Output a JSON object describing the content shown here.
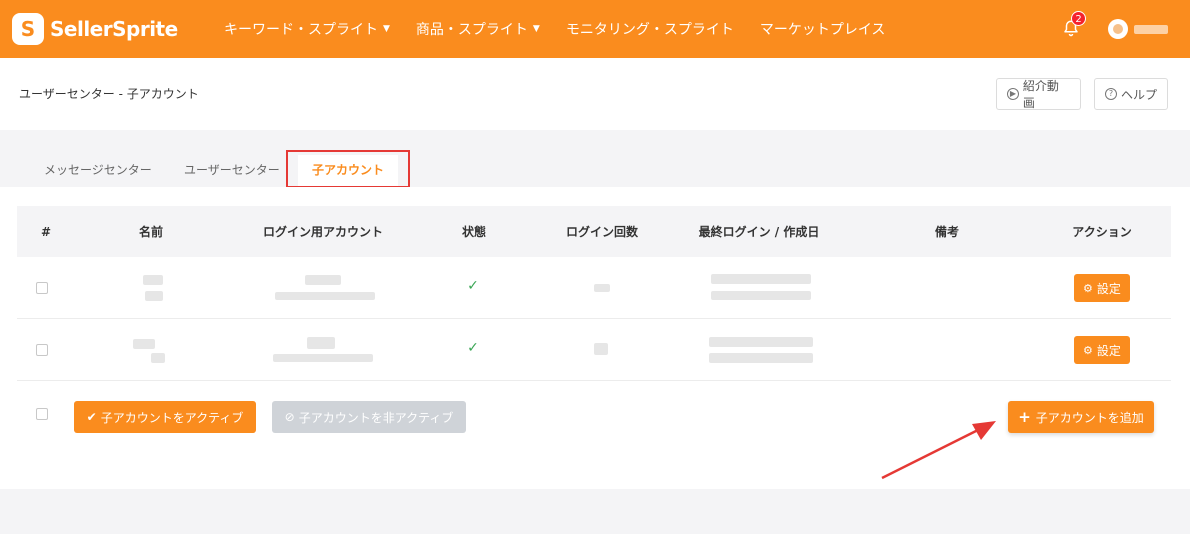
{
  "nav": {
    "brand": "SellerSprite",
    "items": [
      {
        "label": "キーワード・スプライト",
        "has_dropdown": true
      },
      {
        "label": "商品・スプライト",
        "has_dropdown": true
      },
      {
        "label": "モニタリング・スプライト",
        "has_dropdown": false
      },
      {
        "label": "マーケットプレイス",
        "has_dropdown": false
      }
    ],
    "notification_count": "2"
  },
  "header": {
    "breadcrumb": "ユーザーセンター - 子アカウント",
    "video_button": "紹介動画",
    "help_button": "ヘルプ"
  },
  "tabs": {
    "items": [
      "メッセージセンター",
      "ユーザーセンター",
      "子アカウント"
    ],
    "active": "子アカウント"
  },
  "table": {
    "columns": [
      "#",
      "名前",
      "ログイン用アカウント",
      "状態",
      "ログイン回数",
      "最終ログイン / 作成日",
      "備考",
      "アクション"
    ],
    "rows": [
      {
        "status": "✓",
        "action": "設定"
      },
      {
        "status": "✓",
        "action": "設定"
      }
    ]
  },
  "footer": {
    "activate": "子アカウントをアクティブ",
    "deactivate": "子アカウントを非アクティブ",
    "add": "子アカウントを追加"
  },
  "colors": {
    "brand": "#fa8c1e",
    "highlight": "#e53935",
    "check": "#3aa655"
  }
}
